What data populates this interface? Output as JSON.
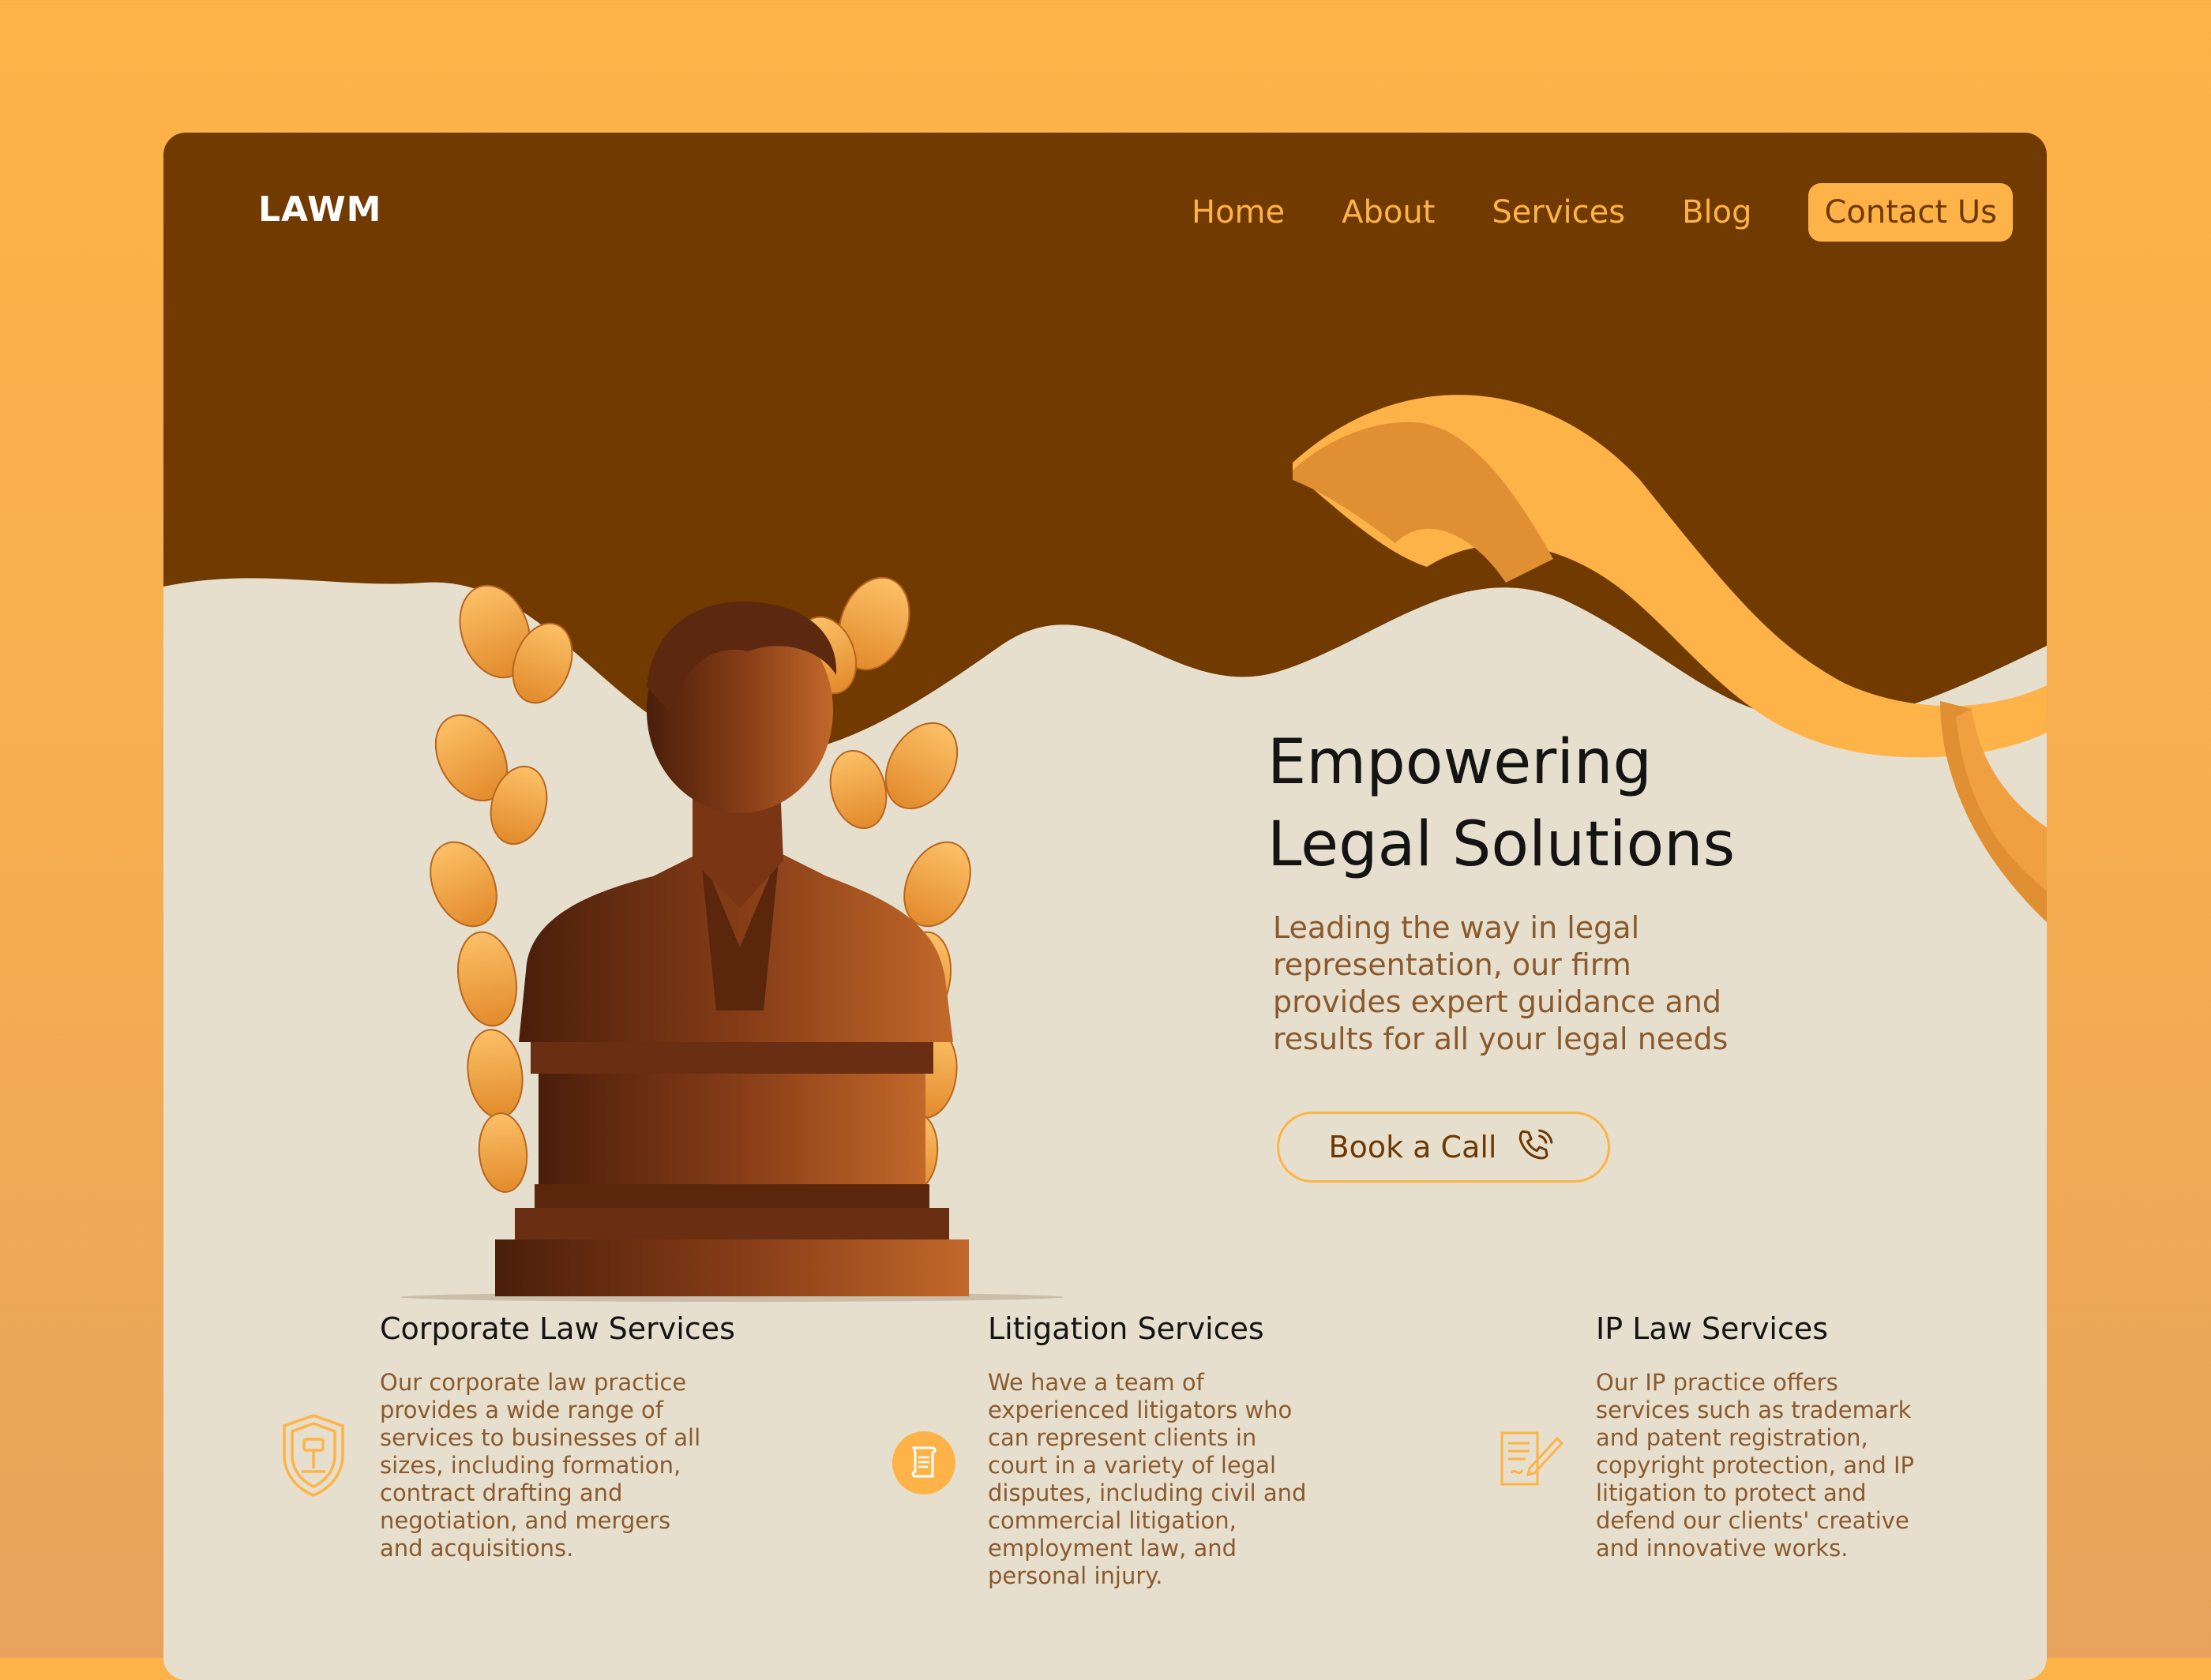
{
  "brand": {
    "logo": "LAWM"
  },
  "nav": {
    "links": [
      "Home",
      "About",
      "Services",
      "Blog"
    ],
    "contact": "Contact Us"
  },
  "hero": {
    "title_line1": "Empowering",
    "title_line2": "Legal Solutions",
    "subtitle": "Leading the way in legal representation, our firm provides expert guidance and results for all your legal needs",
    "cta": "Book a Call",
    "cta_icon": "phone-icon",
    "illustration": "bronze-bust-statue-with-laurel-leaves"
  },
  "services": [
    {
      "title": "Corporate Law Services",
      "icon": "shield-gavel-icon",
      "description": "Our corporate law practice provides a wide range of services to businesses of all sizes, including formation, contract drafting and negotiation, and mergers and acquisitions."
    },
    {
      "title": "Litigation Services",
      "icon": "scroll-document-icon",
      "description": "We have a team of experienced litigators who can represent clients in court in a variety of legal disputes, including civil and commercial litigation, employment law, and personal injury."
    },
    {
      "title": "IP Law Services",
      "icon": "contract-pen-icon",
      "description": "Our IP practice offers services such as trademark and patent registration, copyright protection, and IP litigation to protect and defend our clients' creative and innovative works."
    }
  ],
  "colors": {
    "primary_dark": "#713A00",
    "accent": "#FDB347",
    "cream": "#E7DFCD",
    "text_brown": "#8A5A2E",
    "page_bg": "#F6AE51"
  }
}
